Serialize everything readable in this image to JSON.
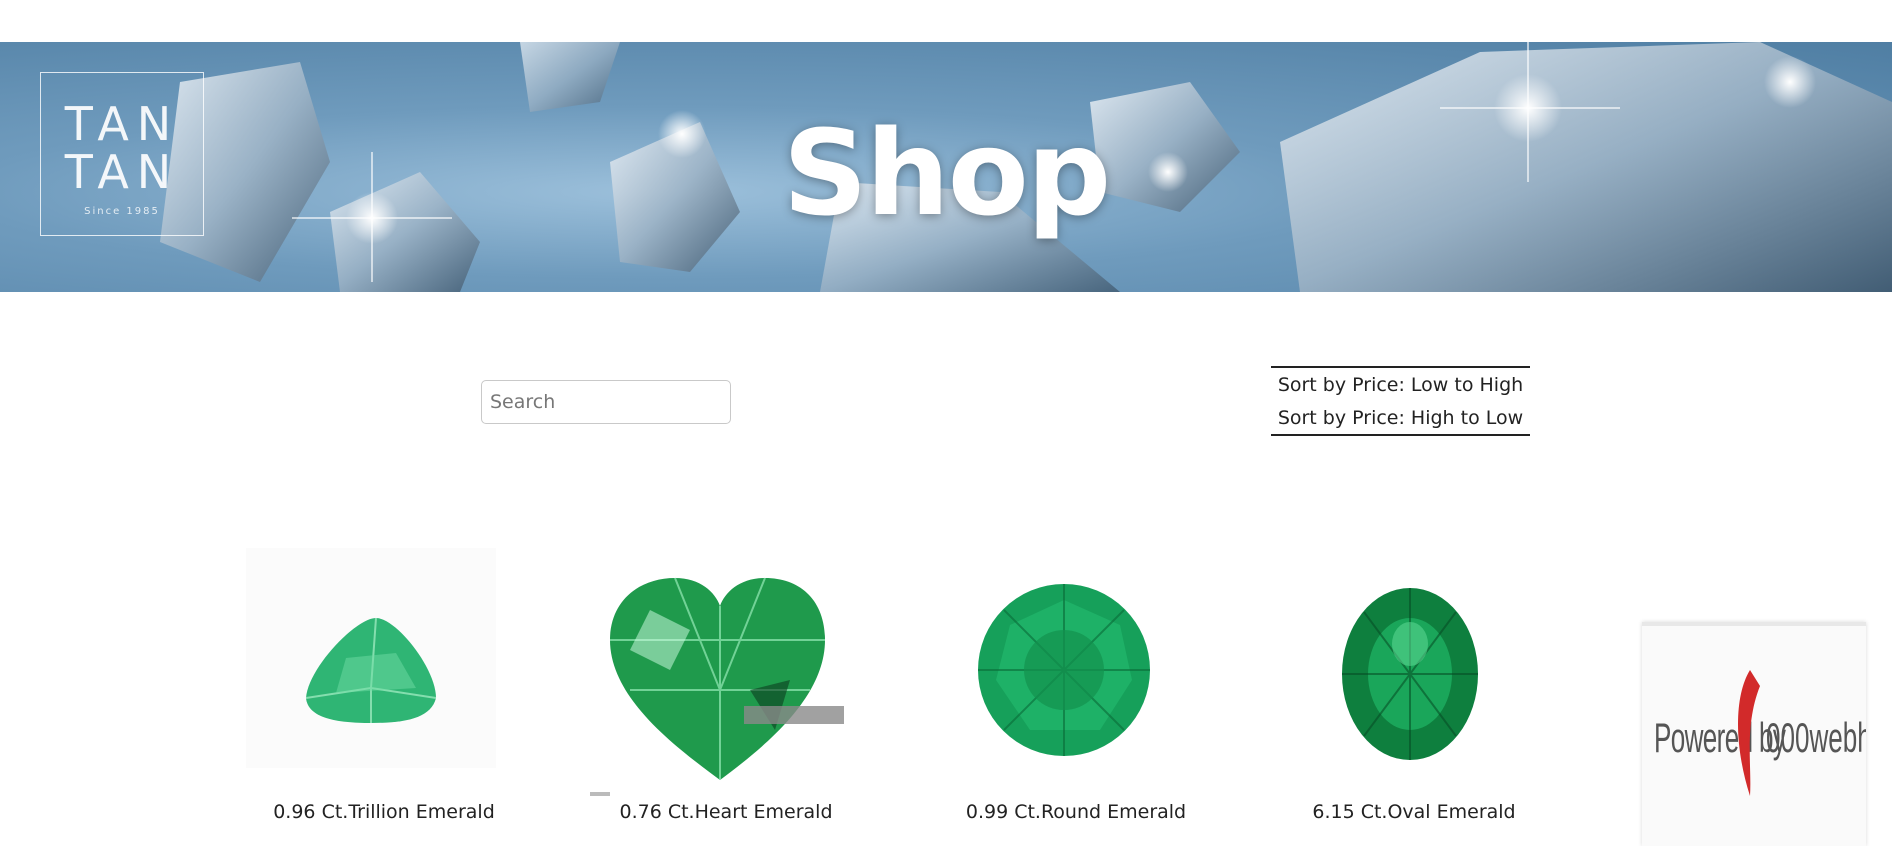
{
  "banner": {
    "title": "Shop",
    "logo": {
      "line1": "TAN",
      "line2": "TAN",
      "since": "Since 1985"
    }
  },
  "search": {
    "placeholder": "Search",
    "value": ""
  },
  "sort": {
    "options": [
      {
        "label": "Sort by Price: Low to High"
      },
      {
        "label": "Sort by Price: High to Low"
      }
    ]
  },
  "products": [
    {
      "name": "0.96 Ct.Trillion Emerald",
      "icon": "trillion-emerald-icon"
    },
    {
      "name": "0.76 Ct.Heart Emerald",
      "icon": "heart-emerald-icon"
    },
    {
      "name": "0.99 Ct.Round Emerald",
      "icon": "round-emerald-icon"
    },
    {
      "name": "6.15 Ct.Oval Emerald",
      "icon": "oval-emerald-icon"
    }
  ],
  "badge": {
    "part1": "Powered by",
    "part2": "000webhost"
  },
  "colors": {
    "emerald": "#17a85a",
    "emerald_dark": "#0b6b35",
    "banner": "#6f9bbd"
  }
}
